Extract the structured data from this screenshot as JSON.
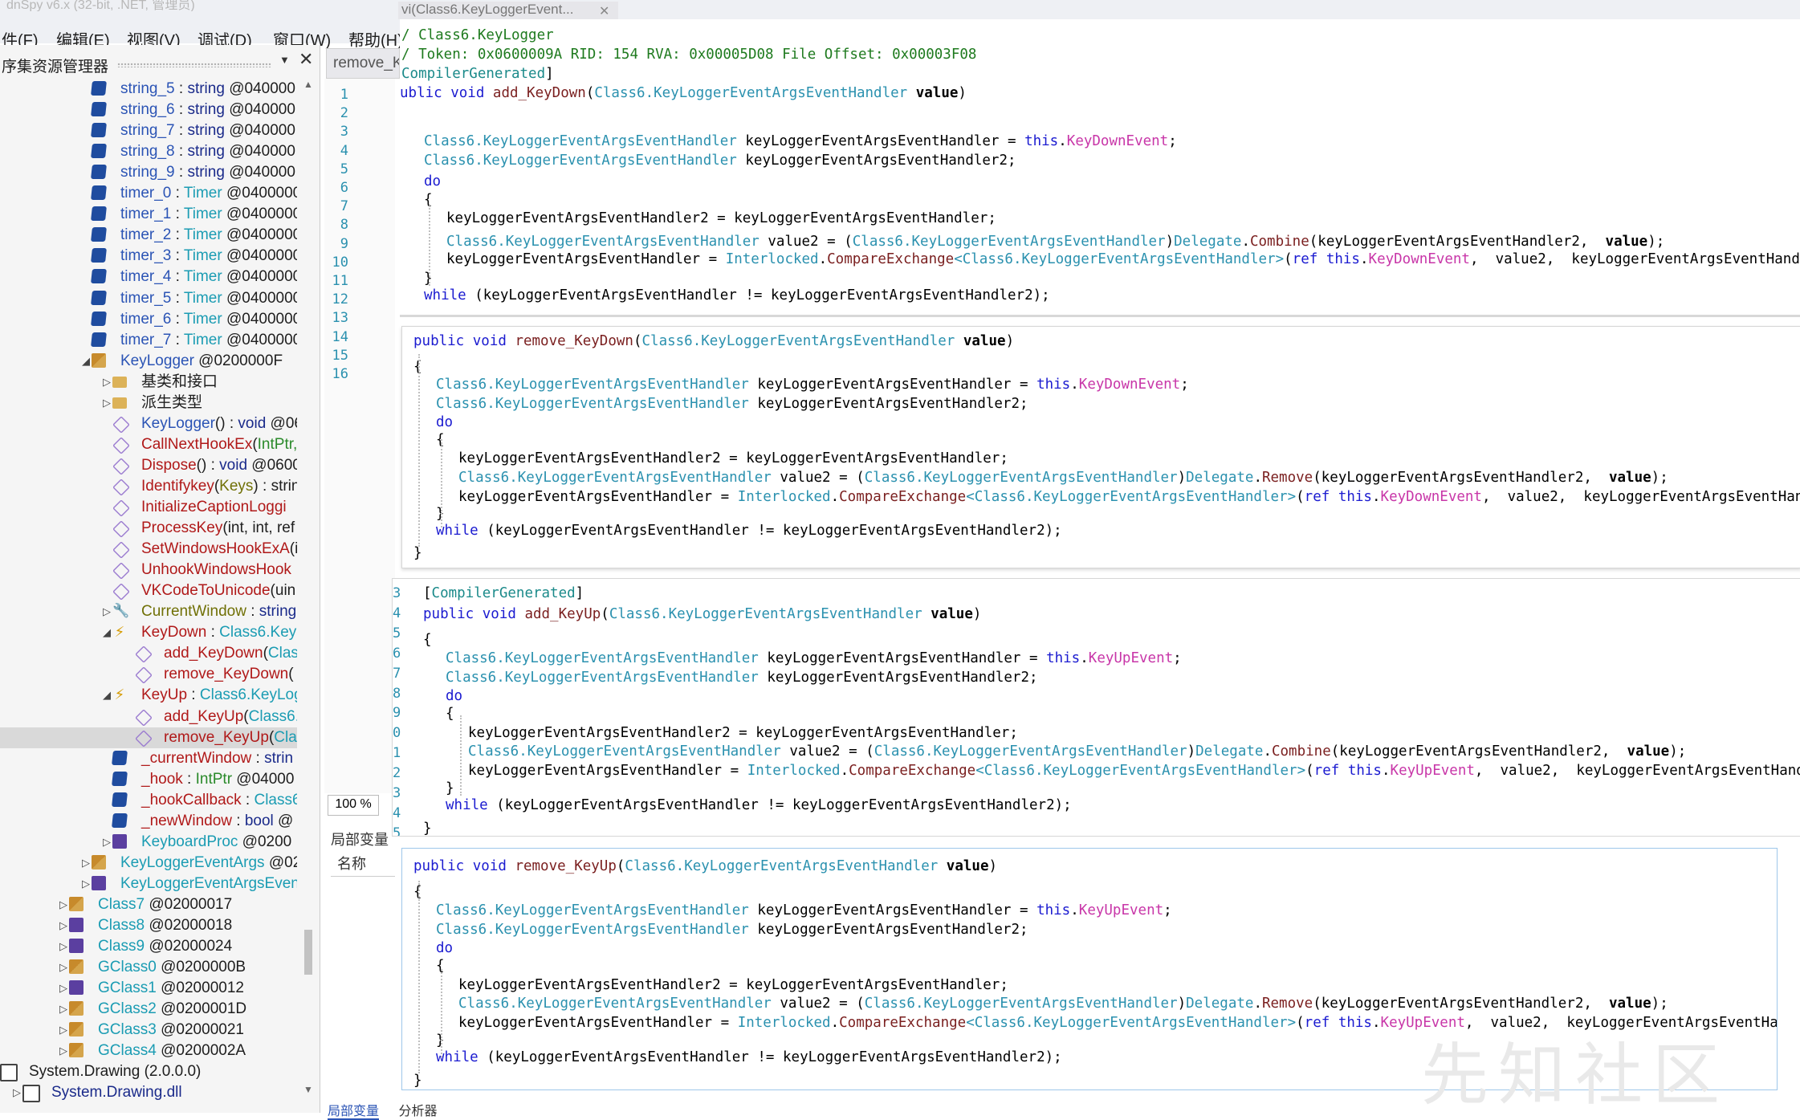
{
  "window_title": "dnSpy v6.x (32-bit, .NET, 管理员)",
  "menu": [
    "件(F)",
    "编辑(E)",
    "视图(V)",
    "调试(D)",
    "窗口(W)",
    "帮助(H)"
  ],
  "explorer": {
    "title": "序集资源管理器",
    "items": [
      {
        "name": "string_5",
        "sep": " : ",
        "type": "string",
        "token": " @040000",
        "kind": "field"
      },
      {
        "name": "string_6",
        "sep": " : ",
        "type": "string",
        "token": " @040000",
        "kind": "field"
      },
      {
        "name": "string_7",
        "sep": " : ",
        "type": "string",
        "token": " @040000",
        "kind": "field"
      },
      {
        "name": "string_8",
        "sep": " : ",
        "type": "string",
        "token": " @040000",
        "kind": "field"
      },
      {
        "name": "string_9",
        "sep": " : ",
        "type": "string",
        "token": " @040000",
        "kind": "field"
      },
      {
        "name": "timer_0",
        "sep": " : ",
        "type": "Timer",
        "token": " @0400000",
        "kind": "field"
      },
      {
        "name": "timer_1",
        "sep": " : ",
        "type": "Timer",
        "token": " @0400000",
        "kind": "field"
      },
      {
        "name": "timer_2",
        "sep": " : ",
        "type": "Timer",
        "token": " @0400000",
        "kind": "field"
      },
      {
        "name": "timer_3",
        "sep": " : ",
        "type": "Timer",
        "token": " @0400000",
        "kind": "field"
      },
      {
        "name": "timer_4",
        "sep": " : ",
        "type": "Timer",
        "token": " @0400000",
        "kind": "field"
      },
      {
        "name": "timer_5",
        "sep": " : ",
        "type": "Timer",
        "token": " @0400000",
        "kind": "field"
      },
      {
        "name": "timer_6",
        "sep": " : ",
        "type": "Timer",
        "token": " @0400000",
        "kind": "field"
      },
      {
        "name": "timer_7",
        "sep": " : ",
        "type": "Timer",
        "token": " @0400000",
        "kind": "field"
      },
      {
        "name": "KeyLogger",
        "sep": "",
        "type": "",
        "token": " @0200000F",
        "kind": "class"
      },
      {
        "name": "基类和接口",
        "sep": "",
        "type": "",
        "token": "",
        "kind": "folder"
      },
      {
        "name": "派生类型",
        "sep": "",
        "type": "",
        "token": "",
        "kind": "folder"
      },
      {
        "name": "KeyLogger",
        "sep": "() : ",
        "type": "void",
        "token": " @06",
        "kind": "method"
      },
      {
        "name": "CallNextHookEx",
        "sep": "(",
        "type": "IntPtr,",
        "token": "",
        "kind": "method"
      },
      {
        "name": "Dispose",
        "sep": "() : ",
        "type": "void",
        "token": " @0600",
        "kind": "method"
      },
      {
        "name": "Identifykey",
        "sep": "(",
        "type": "Keys",
        "token": ") : strin",
        "kind": "method"
      },
      {
        "name": "InitializeCaptionLoggi",
        "sep": "",
        "type": "",
        "token": "",
        "kind": "method"
      },
      {
        "name": "ProcessKey",
        "sep": "(int, int, ref",
        "type": "",
        "token": "",
        "kind": "method"
      },
      {
        "name": "SetWindowsHookExA",
        "sep": "(i",
        "type": "",
        "token": "",
        "kind": "method"
      },
      {
        "name": "UnhookWindowsHook",
        "sep": "",
        "type": "",
        "token": "",
        "kind": "method"
      },
      {
        "name": "VKCodeToUnicode",
        "sep": "(uin",
        "type": "",
        "token": "",
        "kind": "method"
      },
      {
        "name": "CurrentWindow",
        "sep": " : ",
        "type": "string",
        "token": "",
        "kind": "property"
      },
      {
        "name": "KeyDown",
        "sep": " : ",
        "type": "Class6.KeyL",
        "token": "",
        "kind": "event"
      },
      {
        "name": "add_KeyDown",
        "sep": "(",
        "type": "Clas",
        "token": "",
        "kind": "method"
      },
      {
        "name": "remove_KeyDown",
        "sep": "(",
        "type": "",
        "token": "",
        "kind": "method"
      },
      {
        "name": "KeyUp",
        "sep": " : ",
        "type": "Class6.KeyLog",
        "token": "",
        "kind": "event"
      },
      {
        "name": "add_KeyUp",
        "sep": "(",
        "type": "Class6.",
        "token": "",
        "kind": "method"
      },
      {
        "name": "remove_KeyUp",
        "sep": "(",
        "type": "Cla",
        "token": "",
        "kind": "method"
      },
      {
        "name": "_currentWindow",
        "sep": " : ",
        "type": "strin",
        "token": "",
        "kind": "field"
      },
      {
        "name": "_hook",
        "sep": " : ",
        "type": "IntPtr",
        "token": " @04000",
        "kind": "field"
      },
      {
        "name": "_hookCallback",
        "sep": " : ",
        "type": "Class6",
        "token": "",
        "kind": "field"
      },
      {
        "name": "_newWindow",
        "sep": " : ",
        "type": "bool",
        "token": " @",
        "kind": "field"
      },
      {
        "name": "KeyboardProc",
        "sep": "",
        "type": "",
        "token": " @0200",
        "kind": "delegate"
      },
      {
        "name": "KeyLoggerEventArgs",
        "sep": "",
        "type": "",
        "token": " @02",
        "kind": "class"
      },
      {
        "name": "KeyLoggerEventArgsEven",
        "sep": "",
        "type": "",
        "token": "",
        "kind": "delegate"
      },
      {
        "name": "Class7",
        "sep": "",
        "type": "",
        "token": " @02000017",
        "kind": "class"
      },
      {
        "name": "Class8",
        "sep": "",
        "type": "",
        "token": " @02000018",
        "kind": "struct"
      },
      {
        "name": "Class9",
        "sep": "",
        "type": "",
        "token": " @02000024",
        "kind": "struct"
      },
      {
        "name": "GClass0",
        "sep": "",
        "type": "",
        "token": " @0200000B",
        "kind": "class"
      },
      {
        "name": "GClass1",
        "sep": "",
        "type": "",
        "token": " @02000012",
        "kind": "struct"
      },
      {
        "name": "GClass2",
        "sep": "",
        "type": "",
        "token": " @0200001D",
        "kind": "class"
      },
      {
        "name": "GClass3",
        "sep": "",
        "type": "",
        "token": " @02000021",
        "kind": "class"
      },
      {
        "name": "GClass4",
        "sep": "",
        "type": "",
        "token": " @0200002A",
        "kind": "class"
      },
      {
        "name": "System.Drawing",
        "sep": "",
        "type": "",
        "token": " (2.0.0.0)",
        "kind": "assembly"
      },
      {
        "name": "System.Drawing.dll",
        "sep": "",
        "type": "",
        "token": "",
        "kind": "module"
      }
    ]
  },
  "document": {
    "tab": "remove_K",
    "snippet_tab": "vi(Class6.KeyLoggerEvent...",
    "zoom": "100 %",
    "locals_title": "局部变量",
    "locals_col": "名称",
    "bottom_tabs": [
      "局部变量",
      "分析器"
    ],
    "line_numbers": [
      "1",
      "2",
      "3",
      "4",
      "5",
      "6",
      "7",
      "8",
      "9",
      "10",
      "11",
      "12",
      "13",
      "14",
      "15",
      "16"
    ]
  },
  "code": {
    "class_comment": "/ Class6.KeyLogger",
    "token_comment": "/ Token: 0x0600009A RID: 154 RVA: 0x00005D08 File Offset: 0x00003F08",
    "attr": "CompilerGenerated",
    "dtype": "Class6.",
    "htype": "KeyLoggerEventArgsEventHandler",
    "v1": "keyLoggerEventArgsEventHandler",
    "v2": "keyLoggerEventArgsEventHandler2",
    "add_keydown": "add_KeyDown",
    "remove_keydown": "remove_KeyDown",
    "add_keyup": "add_KeyUp",
    "remove_keyup": "remove_KeyUp",
    "keydown_event": "KeyDownEvent",
    "keyup_event": "KeyUpEvent",
    "combine": "Combine",
    "remove": "Remove",
    "interlocked": "Interlocked",
    "cmpxchg": "CompareExchange",
    "delegate": "Delegate"
  },
  "panel3_line_numbers": [
    "3",
    "4",
    "5",
    "6",
    "7",
    "8",
    "9",
    "0",
    "1",
    "2",
    "3",
    "4",
    "5"
  ],
  "watermark": "先知社区",
  "colors": {
    "keyword": "#1b1bd0",
    "type": "#2b91af",
    "method": "#7a1f1f",
    "event": "#c836a8",
    "selection": "#d9d9d9"
  }
}
